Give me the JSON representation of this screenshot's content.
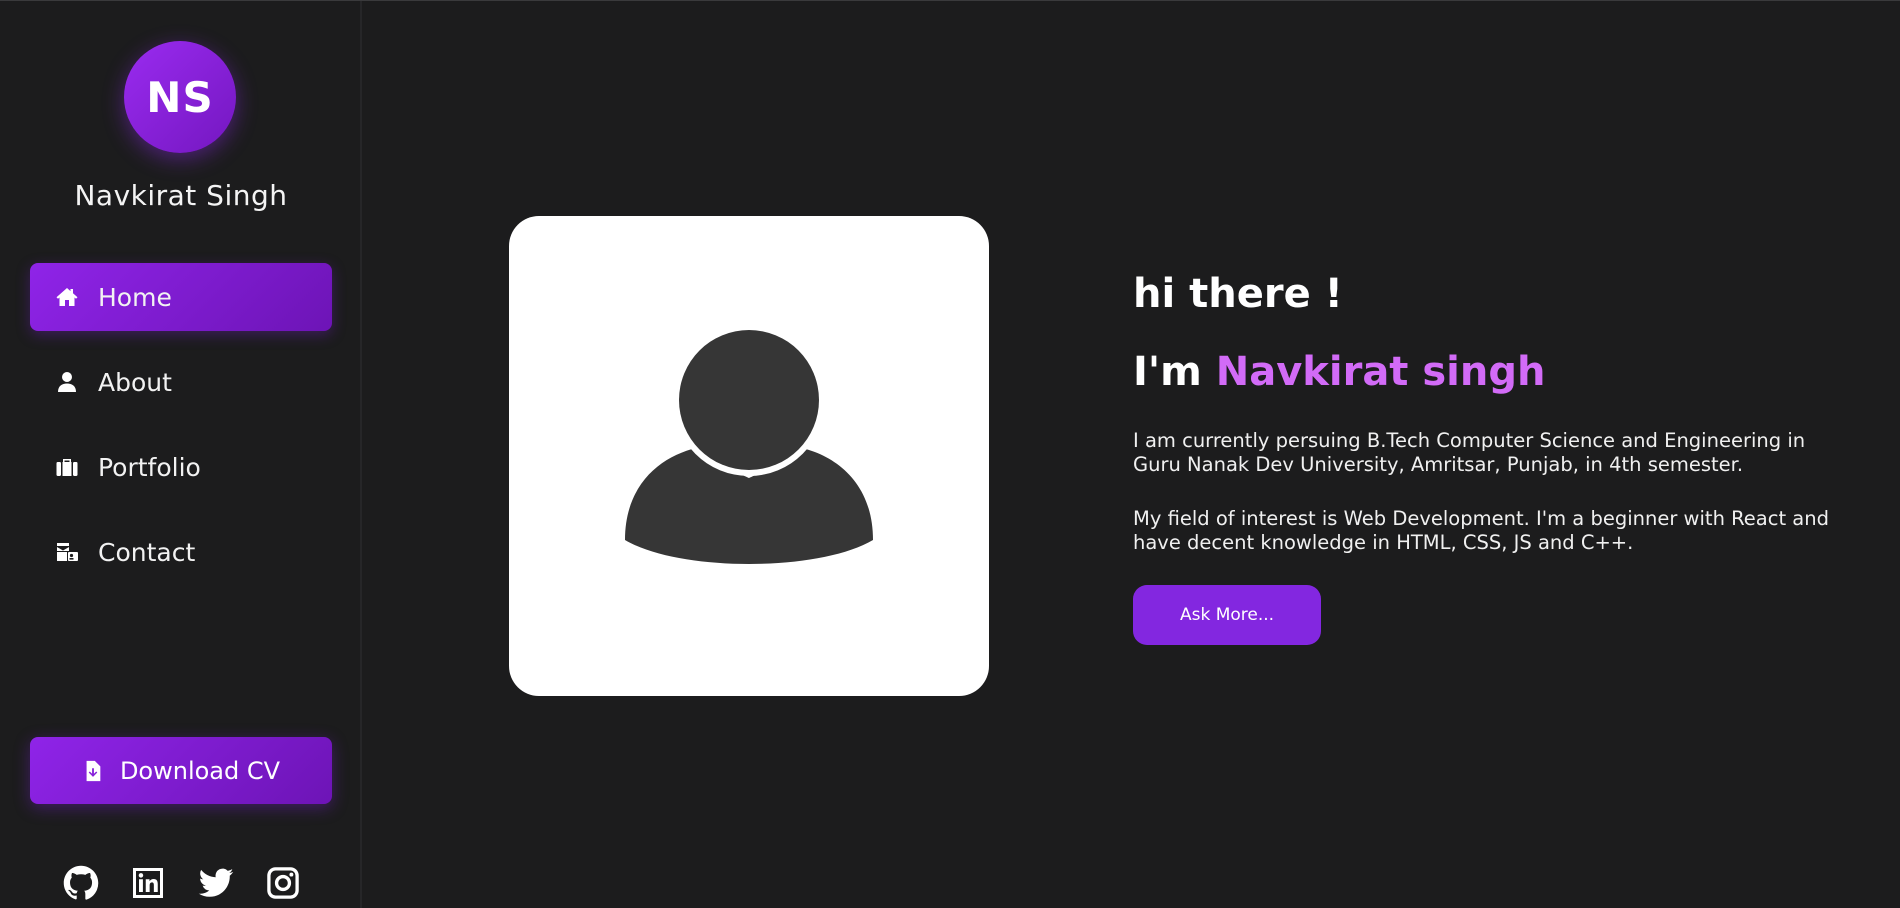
{
  "profile": {
    "initials": "NS",
    "name": "Navkirat Singh"
  },
  "nav": {
    "items": [
      {
        "label": "Home",
        "icon": "home-icon",
        "active": true
      },
      {
        "label": "About",
        "icon": "user-icon",
        "active": false
      },
      {
        "label": "Portfolio",
        "icon": "briefcase-icon",
        "active": false
      },
      {
        "label": "Contact",
        "icon": "contact-card-icon",
        "active": false
      }
    ]
  },
  "sidebar": {
    "download_label": "Download CV",
    "socials": [
      "github-icon",
      "linkedin-icon",
      "twitter-icon",
      "instagram-icon"
    ]
  },
  "hero": {
    "greeting": "hi there !",
    "intro_prefix": "I'm ",
    "intro_name": "Navkirat singh",
    "paragraph1": "I am currently persuing B.Tech Computer Science and Engineering in Guru Nanak Dev University, Amritsar, Punjab, in 4th semester.",
    "paragraph2": "My field of interest is Web Development. I'm a beginner with React and have decent knowledge in HTML, CSS, JS and C++.",
    "button_label": "Ask More..."
  },
  "colors": {
    "accent": "#8f24e8",
    "highlight": "#d26bf7",
    "background": "#1c1c1d"
  }
}
